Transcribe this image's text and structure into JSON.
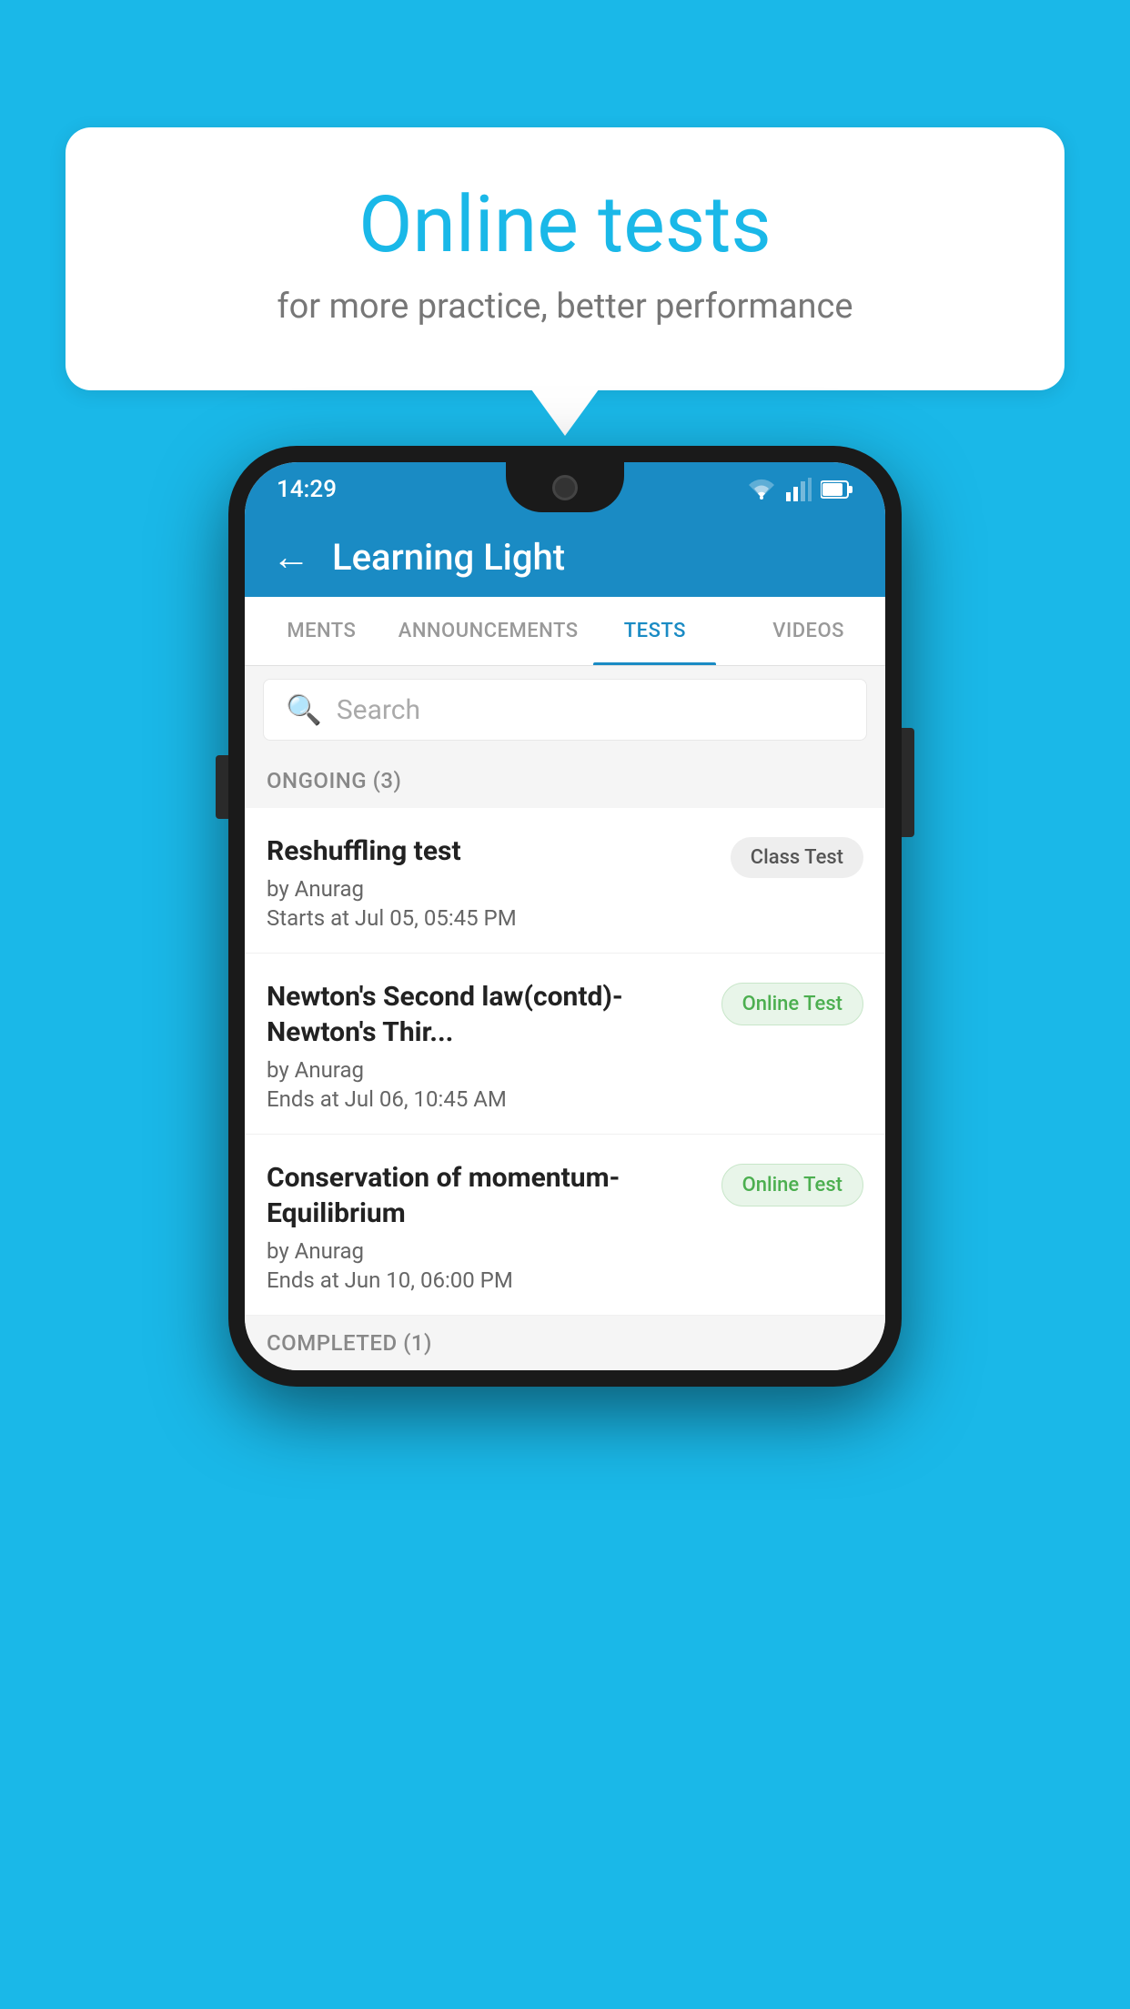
{
  "background_color": "#1ab8e8",
  "speech_bubble": {
    "title": "Online tests",
    "subtitle": "for more practice, better performance"
  },
  "status_bar": {
    "time": "14:29"
  },
  "app_bar": {
    "title": "Learning Light",
    "back_label": "←"
  },
  "tabs": [
    {
      "label": "MENTS",
      "active": false
    },
    {
      "label": "ANNOUNCEMENTS",
      "active": false
    },
    {
      "label": "TESTS",
      "active": true
    },
    {
      "label": "VIDEOS",
      "active": false
    }
  ],
  "search": {
    "placeholder": "Search"
  },
  "ongoing_section": {
    "label": "ONGOING (3)"
  },
  "tests": [
    {
      "name": "Reshuffling test",
      "author": "by Anurag",
      "date": "Starts at  Jul 05, 05:45 PM",
      "badge": "Class Test",
      "badge_type": "class"
    },
    {
      "name": "Newton's Second law(contd)-Newton's Thir...",
      "author": "by Anurag",
      "date": "Ends at  Jul 06, 10:45 AM",
      "badge": "Online Test",
      "badge_type": "online"
    },
    {
      "name": "Conservation of momentum-Equilibrium",
      "author": "by Anurag",
      "date": "Ends at  Jun 10, 06:00 PM",
      "badge": "Online Test",
      "badge_type": "online"
    }
  ],
  "completed_section": {
    "label": "COMPLETED (1)"
  }
}
